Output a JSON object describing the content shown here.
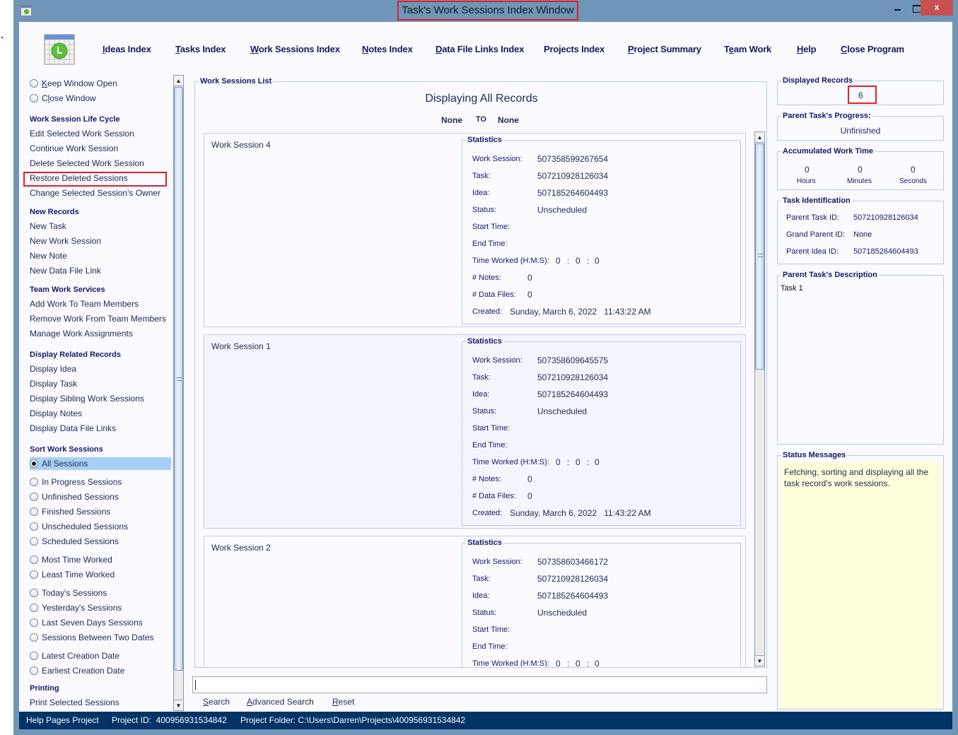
{
  "window": {
    "title": "Task's Work Sessions Index Window",
    "close_glyph": "x"
  },
  "menu": {
    "items": [
      {
        "mnemonic": "I",
        "rest": "deas Index",
        "pre": ""
      },
      {
        "mnemonic": "T",
        "rest": "asks Index",
        "pre": ""
      },
      {
        "mnemonic": "W",
        "rest": "ork Sessions Index",
        "pre": ""
      },
      {
        "mnemonic": "N",
        "rest": "otes Index",
        "pre": ""
      },
      {
        "mnemonic": "D",
        "rest": "ata File Links Index",
        "pre": ""
      },
      {
        "mnemonic": "",
        "rest": "Projects Index",
        "pre": ""
      },
      {
        "mnemonic": "P",
        "rest": "roject Summary",
        "pre": ""
      },
      {
        "mnemonic": "e",
        "rest": "am Work",
        "pre": "T"
      },
      {
        "mnemonic": "H",
        "rest": "elp",
        "pre": ""
      },
      {
        "mnemonic": "C",
        "rest": "lose Program",
        "pre": ""
      }
    ]
  },
  "left": {
    "window_options": [
      {
        "pre": "",
        "mnemonic": "K",
        "rest": "eep Window Open"
      },
      {
        "pre": "C",
        "mnemonic": "l",
        "rest": "ose Window"
      }
    ],
    "lifecycle_header": "Work Session Life Cycle",
    "lifecycle": [
      "Edit Selected Work Session",
      "Continue Work Session",
      "Delete Selected Work Session",
      "Restore Deleted Sessions",
      "Change Selected Session's Owner"
    ],
    "new_header": "New Records",
    "new_records": [
      "New Task",
      "New Work Session",
      "New Note",
      "New Data File Link"
    ],
    "team_header": "Team Work Services",
    "team": [
      "Add Work To Team Members",
      "Remove Work From Team Members",
      "Manage Work Assignments"
    ],
    "related_header": "Display Related Records",
    "related": [
      "Display Idea",
      "Display Task",
      "Display Sibling Work Sessions",
      "Display Notes",
      "Display Data File Links"
    ],
    "sort_header": "Sort Work Sessions",
    "sort_selected": "All Sessions",
    "sort_options": [
      "In Progress Sessions",
      "Unfinished Sessions",
      "Finished Sessions",
      "Unscheduled Sessions",
      "Scheduled Sessions",
      "Most Time Worked",
      "Least Time Worked",
      "Today's Sessions",
      "Yesterday's Sessions",
      "Last Seven Days Sessions",
      "Sessions Between Two Dates",
      "Latest Creation Date",
      "Earliest Creation Date"
    ],
    "print_header": "Printing",
    "print": [
      "Print Selected Sessions"
    ]
  },
  "list": {
    "legend": "Work Sessions List",
    "title": "Displaying All Records",
    "range_from": "None",
    "range_to_label": "TO",
    "range_to": "None",
    "stats_legend": "Statistics",
    "labels": {
      "work_session": "Work Session:",
      "task": "Task:",
      "idea": "Idea:",
      "status": "Status:",
      "start": "Start Time:",
      "end": "End Time:",
      "time_worked": "Time Worked (H:M:S):",
      "notes": "# Notes:",
      "data_files": "# Data Files:",
      "created": "Created:"
    },
    "sessions": [
      {
        "name": "Work Session 4",
        "id": "507358599267654",
        "task": "507210928126034",
        "idea": "507185264604493",
        "status": "Unscheduled",
        "start": "",
        "end": "",
        "h": "0",
        "m": "0",
        "s": "0",
        "notes": "0",
        "files": "0",
        "created": "Sunday, March 6, 2022   11:43:22 AM"
      },
      {
        "name": "Work Session 1",
        "id": "507358609645575",
        "task": "507210928126034",
        "idea": "507185264604493",
        "status": "Unscheduled",
        "start": "",
        "end": "",
        "h": "0",
        "m": "0",
        "s": "0",
        "notes": "0",
        "files": "0",
        "created": "Sunday, March 6, 2022   11:43:22 AM"
      },
      {
        "name": "Work Session 2",
        "id": "507358603466172",
        "task": "507210928126034",
        "idea": "507185264604493",
        "status": "Unscheduled",
        "start": "",
        "end": "",
        "h": "0",
        "m": "0",
        "s": "0"
      }
    ],
    "colon": ":"
  },
  "search": {
    "value": "",
    "buttons": [
      {
        "mnemonic": "S",
        "rest": "earch"
      },
      {
        "mnemonic": "A",
        "rest": "dvanced Search"
      },
      {
        "mnemonic": "R",
        "rest": "eset"
      }
    ]
  },
  "right": {
    "displayed_legend": "Displayed Records",
    "displayed_count": "6",
    "progress_legend": "Parent Task's Progress:",
    "progress": "Unfinished",
    "accum_legend": "Accumulated Work Time",
    "hours": "0",
    "minutes": "0",
    "seconds": "0",
    "hours_label": "Hours",
    "minutes_label": "Minutes",
    "seconds_label": "Seconds",
    "taskid_legend": "Task Identification",
    "parent_task_label": "Parent Task ID:",
    "parent_task": "507210928126034",
    "grand_parent_label": "Grand Parent ID:",
    "grand_parent": "None",
    "parent_idea_label": "Parent Idea ID:",
    "parent_idea": "507185264604493",
    "desc_legend": "Parent Task's Description",
    "description": "Task 1",
    "status_legend": "Status Messages",
    "status_message": "Fetching, sorting and displaying all the task record's work sessions."
  },
  "statusbar": {
    "project": "Help Pages Project",
    "project_id": "Project ID:  400956931534842",
    "project_folder": "Project Folder: C:\\Users\\Darren\\Projects\\400956931534842"
  }
}
